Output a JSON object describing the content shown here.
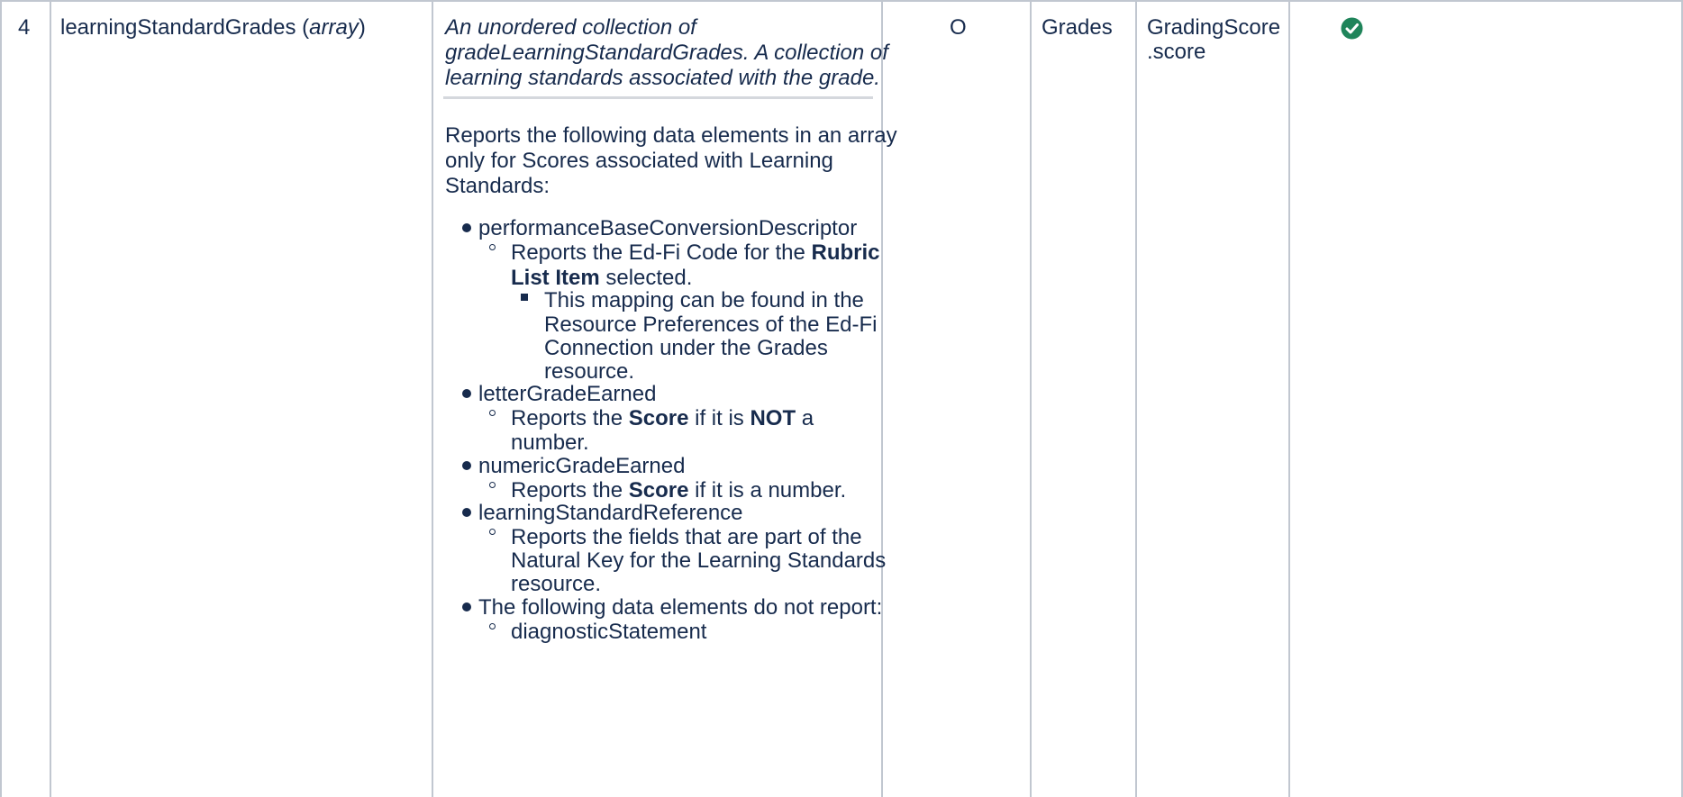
{
  "row": {
    "number": "4",
    "element_name": "learningStandardGrades (",
    "element_type": "array",
    "element_close": ")",
    "description_lines": [
      "An unordered collection of",
      "gradeLearningStandardGrades. A collection of",
      "learning standards associated with the grade."
    ],
    "intro_lines": [
      "Reports the following data elements in an array",
      "only for Scores associated with Learning",
      "Standards:"
    ],
    "items": [
      {
        "label": "performanceBaseConversionDescriptor",
        "sub_pre": "Reports the Ed-Fi Code for the ",
        "sub_bold1": "Rubric",
        "sub_bold2": "List Item",
        "sub_post": " selected.",
        "subsub_lines": [
          "This mapping can be found in the",
          "Resource Preferences of the Ed-Fi",
          "Connection under the Grades",
          "resource."
        ]
      },
      {
        "label": "letterGradeEarned",
        "sub_pre": "Reports the ",
        "sub_bold1": "Score",
        "sub_mid": " if it is ",
        "sub_bold2": "NOT",
        "sub_post": " a",
        "sub_line2": "number."
      },
      {
        "label": "numericGradeEarned",
        "sub_pre": "Reports the ",
        "sub_bold1": "Score",
        "sub_post": " if it is a number."
      },
      {
        "label": "learningStandardReference",
        "sub_lines": [
          "Reports the fields that are part of the",
          "Natural Key for the Learning Standards",
          "resource."
        ]
      },
      {
        "label": "The following data elements do not report:",
        "sub_lines": [
          "diagnosticStatement"
        ]
      }
    ],
    "optionality": "O",
    "resource": "Grades",
    "source_lines": [
      "GradingScore",
      ".score"
    ],
    "status_icon": "check-circle-icon",
    "status_color": "#1f845a"
  }
}
